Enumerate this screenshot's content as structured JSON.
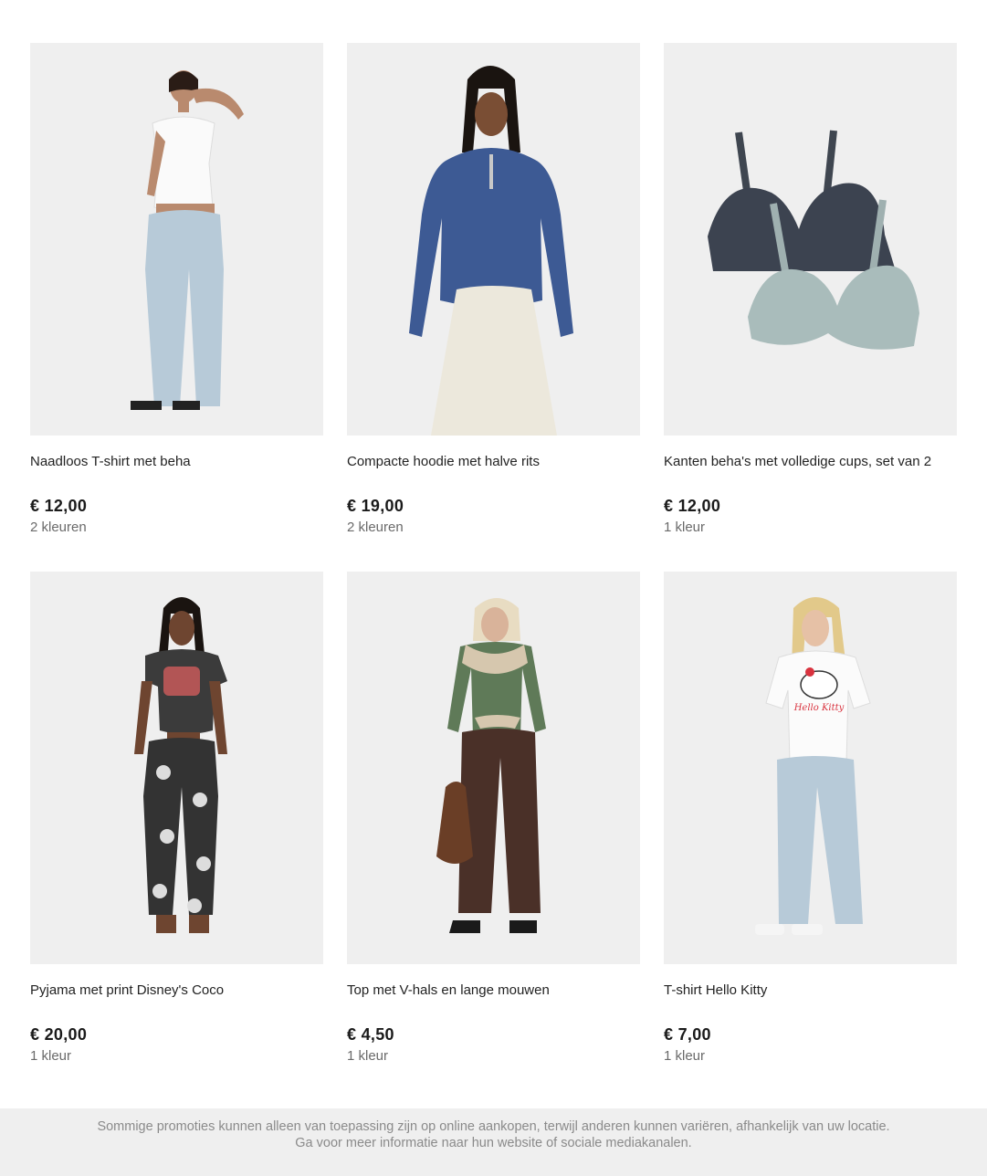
{
  "products": [
    {
      "title": "Naadloos T-shirt met beha",
      "price": "€ 12,00",
      "colors": "2 kleuren",
      "icon": "model-white-top-light-jeans"
    },
    {
      "title": "Compacte hoodie met halve rits",
      "price": "€ 19,00",
      "colors": "2 kleuren",
      "icon": "model-blue-hoodie-cream-trousers"
    },
    {
      "title": "Kanten beha's met volledige cups, set van 2",
      "price": "€ 12,00",
      "colors": "1 kleur",
      "icon": "two-lace-bras"
    },
    {
      "title": "Pyjama met print Disney's Coco",
      "price": "€ 20,00",
      "colors": "1 kleur",
      "icon": "model-coco-pyjama"
    },
    {
      "title": "Top met V-hals en lange mouwen",
      "price": "€ 4,50",
      "colors": "1 kleur",
      "icon": "model-green-top-brown-trousers"
    },
    {
      "title": "T-shirt Hello Kitty",
      "price": "€ 7,00",
      "colors": "1 kleur",
      "icon": "model-hello-kitty-tee-jeans"
    }
  ],
  "footer": {
    "disclaimer": "Sommige promoties kunnen alleen van toepassing zijn op online aankopen, terwijl anderen kunnen variëren, afhankelijk van uw locatie. Ga voor meer informatie naar hun website of sociale mediakanalen."
  }
}
